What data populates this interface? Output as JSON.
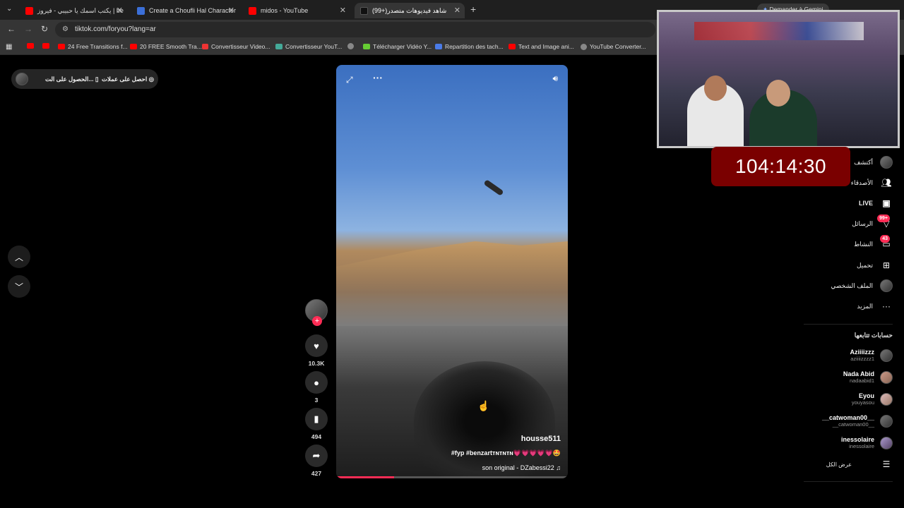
{
  "browser": {
    "tabs": [
      {
        "label": "يكتب اسمك يا حبيبي - فيروز | be",
        "favicon": "youtube",
        "active": false
      },
      {
        "label": "Create a Choufli Hal Character",
        "favicon": "generic",
        "active": false
      },
      {
        "label": "midos - YouTube",
        "favicon": "youtube",
        "active": false
      },
      {
        "label": "(99+)شاهد فيديوهات متصدر",
        "favicon": "tiktok",
        "active": true
      }
    ],
    "new_tab": "+",
    "gemini_button": "Demander à Gemini",
    "url": "tiktok.com/foryou?lang=ar",
    "bookmarks": [
      {
        "label": "",
        "favicon": "youtube"
      },
      {
        "label": "",
        "favicon": "youtube"
      },
      {
        "label": "24 Free Transitions f...",
        "favicon": "youtube"
      },
      {
        "label": "20 FREE Smooth Tra...",
        "favicon": "youtube"
      },
      {
        "label": "Convertisseur Video...",
        "favicon": "z"
      },
      {
        "label": "Convertisseur YouT...",
        "favicon": "generic"
      },
      {
        "label": "",
        "favicon": "globe"
      },
      {
        "label": "Télécharger Vidéo Y...",
        "favicon": "download"
      },
      {
        "label": "Repartition des tach...",
        "favicon": "docs"
      },
      {
        "label": "Text and Image ani...",
        "favicon": "youtube"
      },
      {
        "label": "YouTube Converter...",
        "favicon": "globe"
      }
    ]
  },
  "topbar": {
    "get_coins": "احصل على عملات",
    "get_app": "الحصول على الت..."
  },
  "video": {
    "author": "housse511",
    "caption": "#fyp #benzartᴛɴᴛɴᴛɴ💗💗💗💗💗🤩",
    "sound": "son original - DZabessi22",
    "progress_fraction": 0.25
  },
  "actions": {
    "likes": "10.3K",
    "comments": "3",
    "saves": "494",
    "shares": "427"
  },
  "stream": {
    "timer": "104:14:30"
  },
  "sidebar": {
    "items": [
      {
        "label": "أكتشف",
        "icon": "compass-icon"
      },
      {
        "label": "الأصدقاء",
        "icon": "friends-icon"
      },
      {
        "label": "LIVE",
        "icon": "live-icon"
      },
      {
        "label": "الرسائل",
        "icon": "messages-icon",
        "badge": "99+"
      },
      {
        "label": "النشاط",
        "icon": "activity-icon",
        "badge": "43"
      },
      {
        "label": "تحميل",
        "icon": "upload-icon"
      },
      {
        "label": "الملف الشخصي",
        "icon": "profile-icon"
      },
      {
        "label": "المزيد",
        "icon": "more-icon"
      }
    ],
    "following_title": "حسابات تتابعها",
    "following": [
      {
        "name": "Aziiiizzz",
        "username": "aziiiizzzz1"
      },
      {
        "name": "Nada Abid",
        "username": "nadaabid1"
      },
      {
        "name": "Eyou",
        "username": "youyasou"
      },
      {
        "name": "__catwoman00__",
        "username": "__catwoman00__"
      },
      {
        "name": "inessolaire",
        "username": "inessolaire"
      }
    ],
    "see_all": "عرض الكل"
  },
  "colors": {
    "accent": "#fe2c55",
    "timer_bg": "#7a0000"
  }
}
